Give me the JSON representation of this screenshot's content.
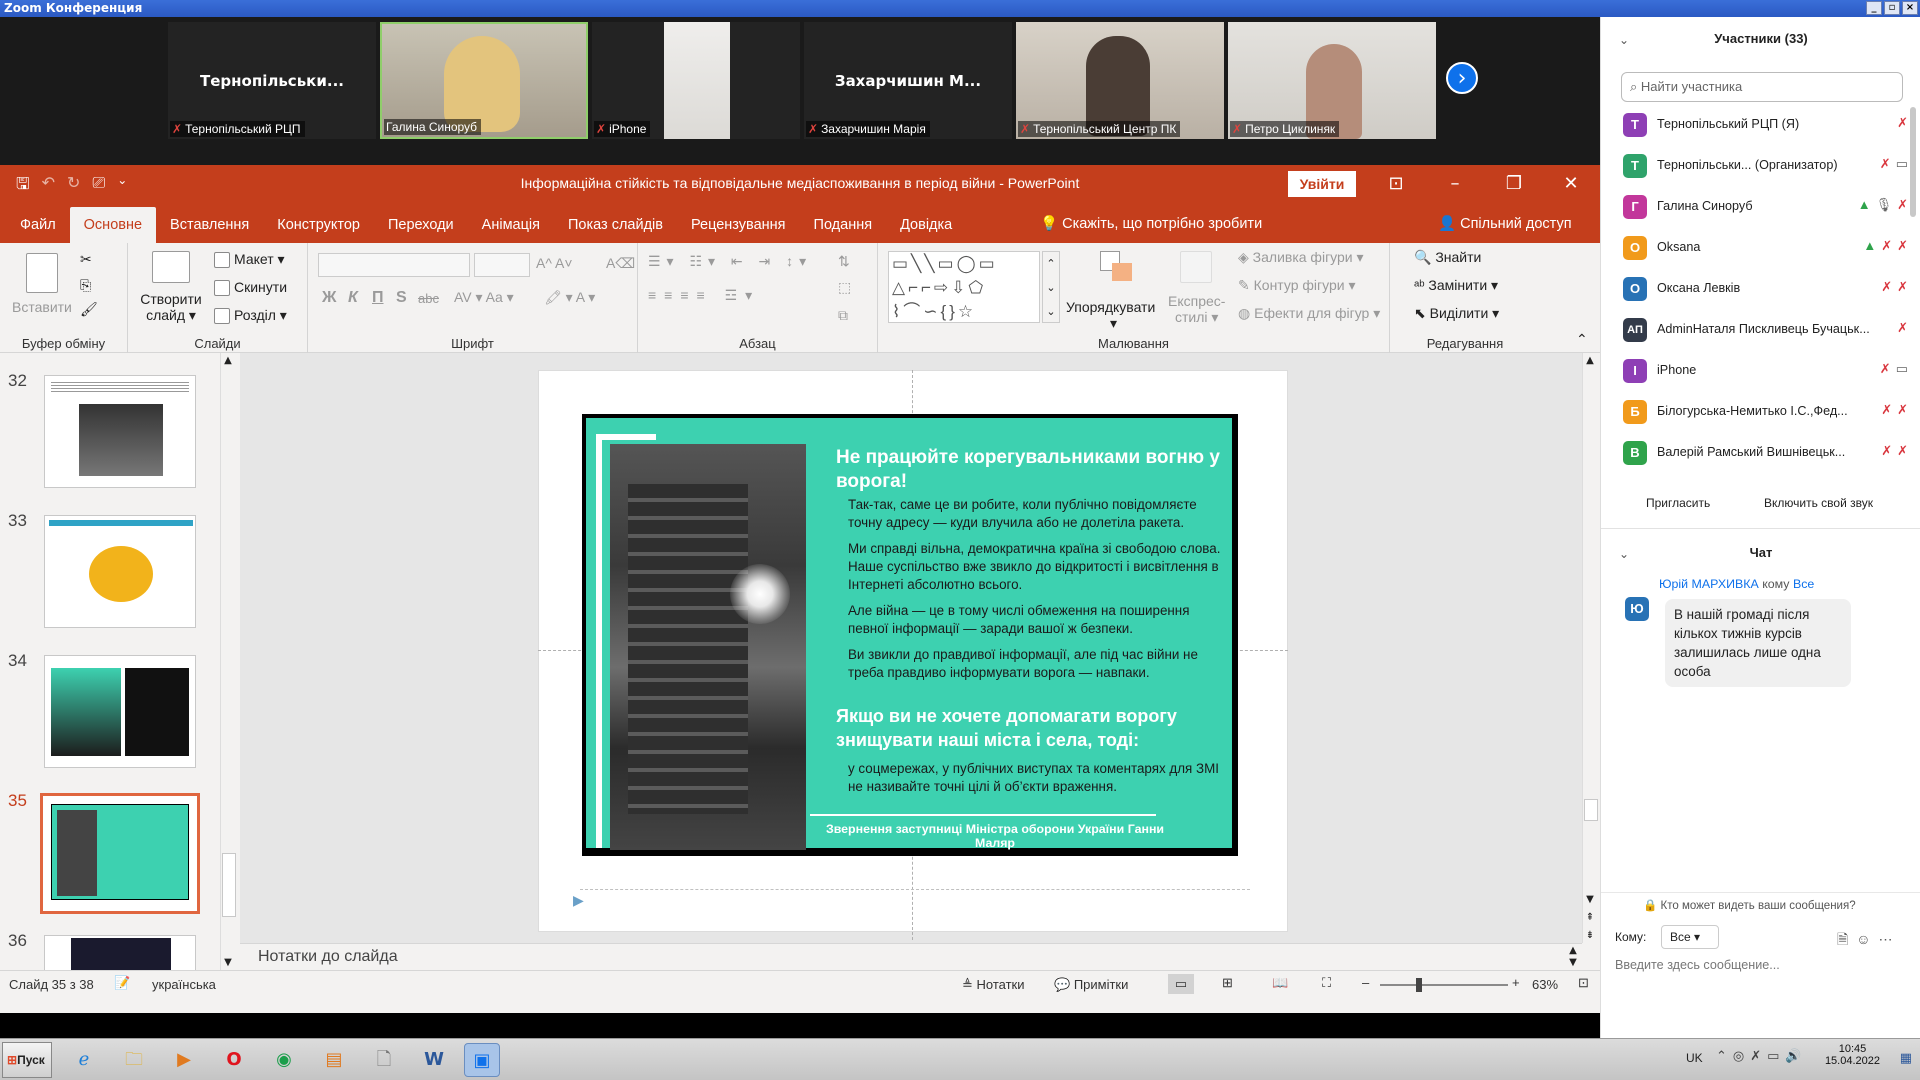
{
  "window": {
    "title": "Zoom Конференция"
  },
  "gallery": [
    {
      "display": "Тернопільськи...",
      "caption": "Тернопільський РЦП"
    },
    {
      "display": "",
      "caption": "Галина Синоруб"
    },
    {
      "display": "",
      "caption": "iPhone"
    },
    {
      "display": "Захарчишин М...",
      "caption": "Захарчишин Марія"
    },
    {
      "display": "",
      "caption": "Тернопільський Центр ПК"
    },
    {
      "display": "",
      "caption": "Петро Циклиняк"
    }
  ],
  "ppt": {
    "doc_title": "Інформаційна стійкість та відповідальне медіаспоживання в період війни  -  PowerPoint",
    "signin": "Увійти",
    "tabs": [
      "Файл",
      "Основне",
      "Вставлення",
      "Конструктор",
      "Переходи",
      "Анімація",
      "Показ слайдів",
      "Рецензування",
      "Подання",
      "Довідка"
    ],
    "tell_me": "Скажіть, що потрібно зробити",
    "share": "Спільний доступ",
    "ribbon": {
      "paste": "Вставити",
      "clipboard": "Буфер обміну",
      "new_slide_1": "Створити",
      "new_slide_2": "слайд",
      "layout": "Макет",
      "reset": "Скинути",
      "section": "Розділ",
      "slides": "Слайди",
      "bold": "Ж",
      "italic": "К",
      "underline": "П",
      "shadow": "S",
      "strike": "abc",
      "font": "Шрифт",
      "paragraph": "Абзац",
      "arrange": "Упорядкувати",
      "quick_styles_1": "Експрес-",
      "quick_styles_2": "стилі",
      "shape_fill": "Заливка фігури",
      "shape_outline": "Контур фігури",
      "shape_effects": "Ефекти для фігур",
      "drawing": "Малювання",
      "find": "Знайти",
      "replace": "Замінити",
      "select": "Виділити",
      "editing": "Редагування"
    },
    "slide_numbers": [
      "32",
      "33",
      "34",
      "35",
      "36"
    ],
    "slide": {
      "title": "Не працюйте корегувальниками вогню у ворога!",
      "p1": "Так-так, саме це ви робите, коли публічно повідомляєте точну адресу — куди влучила або не долетіла ракета.",
      "p2": "Ми справді вільна, демократична країна зі свободою слова. Наше суспільство вже звикло до відкритості і висвітлення в Інтернеті абсолютно всього.",
      "p3": "Але війна — це в тому числі обмеження на поширення певної інформації — заради вашої ж безпеки.",
      "p4": "Ви звикли до правдивої інформації, але під час війни не треба правдиво інформувати ворога — навпаки.",
      "subtitle": "Якщо ви не хочете допомагати ворогу знищувати наші міста і села, тоді:",
      "p5": "у соцмережах, у публічних виступах та коментарях для ЗМІ не називайте точні цілі й об’єкти враження.",
      "footer": "Звернення заступниці Міністра оборони України Ганни Маляр"
    },
    "notes_placeholder": "Нотатки до слайда",
    "status": {
      "slide_of": "Слайд 35 з 38",
      "language": "українська",
      "notes": "Нотатки",
      "comments": "Примітки",
      "zoom": "63%"
    }
  },
  "panel": {
    "participants_title": "Участники (33)",
    "search_placeholder": "Найти участника",
    "participants": [
      {
        "initial": "Т",
        "name": "Тернопільський РЦП (Я)",
        "color": "#8e3fb5"
      },
      {
        "initial": "Т",
        "name": "Тернопільськи...  (Организатор)",
        "color": "#2fa36b"
      },
      {
        "initial": "Г",
        "name": "Галина Синоруб",
        "color": "#c2379b"
      },
      {
        "initial": "O",
        "name": "Oksana",
        "color": "#f19a1b"
      },
      {
        "initial": "О",
        "name": " Оксана Левків",
        "color": "#2872b5"
      },
      {
        "initial": "АП",
        "name": "AdminНаталя Пискливець Бучацьк...",
        "color": "#333b4a"
      },
      {
        "initial": "I",
        "name": "iPhone",
        "color": "#8e3fb5"
      },
      {
        "initial": "Б",
        "name": "Білогурська-Немитько І.С.,Фед...",
        "color": "#f19a1b"
      },
      {
        "initial": "В",
        "name": "Валерій Рамський Вишнівецьк...",
        "color": "#2fa34b"
      }
    ],
    "invite": "Пригласить",
    "unmute": "Включить свой звук",
    "chat_title": "Чат",
    "chat_sender": "Юрій МАРХИВКА",
    "chat_to_word": "кому",
    "chat_to_all": "Все",
    "chat_avatar": "Ю",
    "chat_message": "В нашій громаді після кількох тижнів курсів залишилась лише одна особа",
    "who_can_see": "Кто может видеть ваши сообщения?",
    "to_label": "Кому:",
    "to_value": "Все",
    "input_placeholder": "Введите здесь сообщение..."
  },
  "taskbar": {
    "start": "Пуск",
    "lang": "UK",
    "time": "10:45",
    "date": "15.04.2022"
  },
  "colors": {
    "ppt_accent": "#c43e1c",
    "slide_teal": "#3dd1b0",
    "zoom_blue": "#0e71eb"
  }
}
